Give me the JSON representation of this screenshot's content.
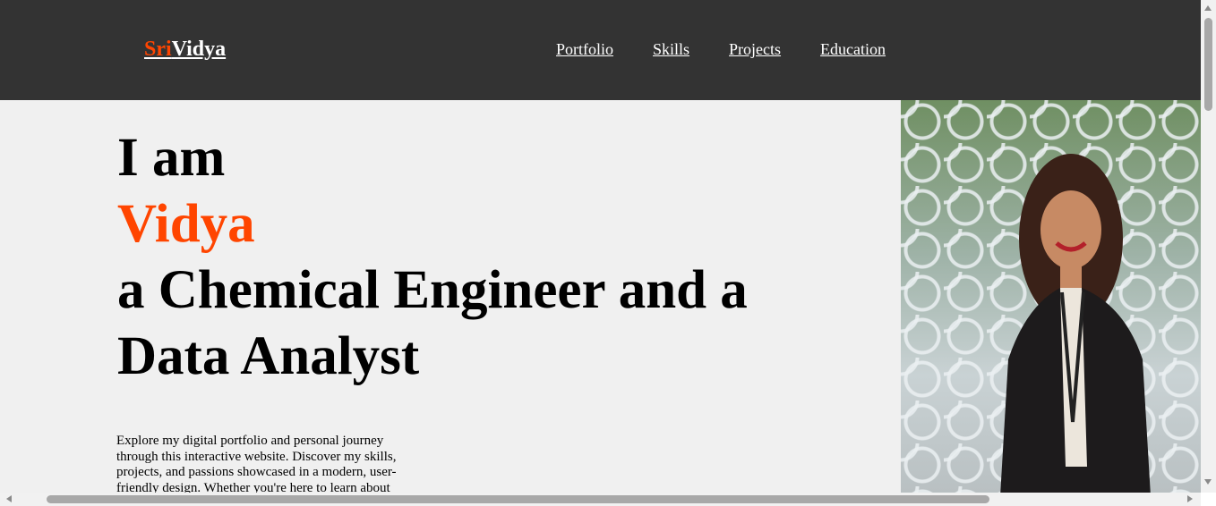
{
  "header": {
    "logo_accent": "Sri",
    "logo_rest": "Vidya",
    "nav": [
      {
        "label": "Portfolio"
      },
      {
        "label": "Skills"
      },
      {
        "label": "Projects"
      },
      {
        "label": "Education"
      }
    ]
  },
  "hero": {
    "line1": "I am",
    "name": "Vidya",
    "line3": "a Chemical Engineer and a",
    "line4": "Data Analyst",
    "intro": "Explore my digital portfolio and personal journey through this interactive website. Discover my skills, projects, and passions showcased in a modern, user-friendly design. Whether you're here to learn about"
  },
  "colors": {
    "navbar_bg": "#333333",
    "accent": "#ff4500",
    "page_bg": "#f0f0f0",
    "text": "#000000"
  },
  "icons": {
    "scroll_up": "arrow-up-icon",
    "scroll_down": "arrow-down-icon",
    "scroll_left": "arrow-left-icon",
    "scroll_right": "arrow-right-icon"
  }
}
